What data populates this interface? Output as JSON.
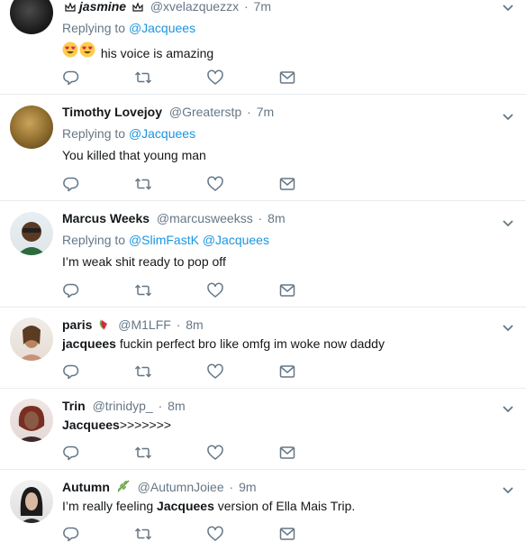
{
  "tweets": [
    {
      "fullname": "jasmine",
      "handle": "@xvelazquezzx",
      "dot": "·",
      "time": "7m",
      "replying_prefix": "Replying to ",
      "mentions": [
        "@Jacquees"
      ],
      "text": "his voice is amazing"
    },
    {
      "fullname": "Timothy Lovejoy",
      "handle": "@Greaterstp",
      "dot": "·",
      "time": "7m",
      "replying_prefix": "Replying to ",
      "mentions": [
        "@Jacquees"
      ],
      "text": "You killed that young man"
    },
    {
      "fullname": "Marcus Weeks",
      "handle": "@marcusweekss",
      "dot": "·",
      "time": "8m",
      "replying_prefix": "Replying to ",
      "mentions": [
        "@SlimFastK",
        "@Jacquees"
      ],
      "text": "I’m weak shit ready to pop off"
    },
    {
      "fullname": "paris",
      "handle": "@M1LFF",
      "dot": "·",
      "time": "8m",
      "text_bold": "jacquees",
      "text": " fuckin perfect bro like omfg im woke now daddy"
    },
    {
      "fullname": "Trin",
      "handle": "@trinidyp_",
      "dot": "·",
      "time": "8m",
      "text_bold": "Jacquees",
      "text": ">>>>>>>"
    },
    {
      "fullname": "Autumn",
      "handle": "@AutumnJoiee",
      "dot": "·",
      "time": "9m",
      "text_pre": "I’m really feeling ",
      "text_bold": "Jacquees",
      "text": " version of Ella Mais Trip."
    }
  ],
  "colors": {
    "link": "#1b95e0",
    "secondary_text": "#657786",
    "divider": "#e6ecf0"
  },
  "icons": [
    "reply-icon",
    "retweet-icon",
    "like-icon",
    "direct-message-icon",
    "caret-down-icon"
  ]
}
